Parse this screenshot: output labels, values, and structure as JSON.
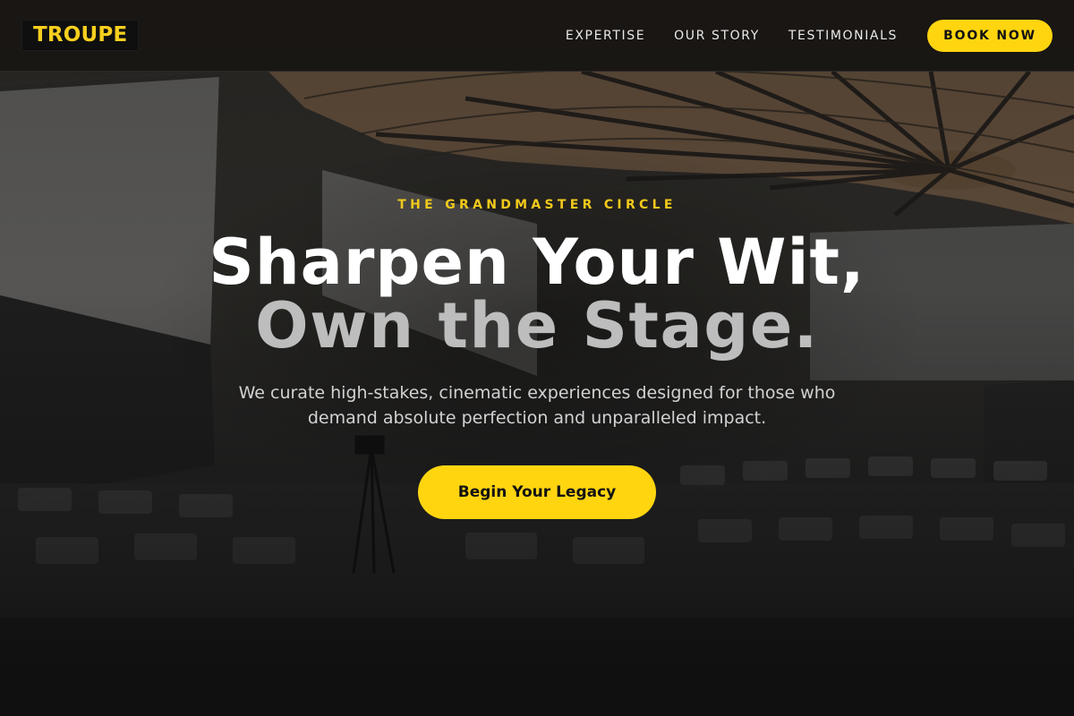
{
  "header": {
    "logo": "TROUPE",
    "nav": [
      {
        "label": "EXPERTISE"
      },
      {
        "label": "OUR STORY"
      },
      {
        "label": "TESTIMONIALS"
      }
    ],
    "cta_label": "BOOK NOW"
  },
  "hero": {
    "background_image": "auditorium-icon",
    "eyebrow": "THE GRANDMASTER CIRCLE",
    "headline_line1": "Sharpen Your Wit,",
    "headline_line2": "Own the Stage.",
    "subtitle": "We curate high-stakes, cinematic experiences designed for those who demand absolute perfection and unparalleled impact.",
    "cta_label": "Begin Your Legacy"
  },
  "colors": {
    "accent": "#ffd510",
    "eyebrow": "#f2c91b",
    "header_bg": "#181614",
    "text_primary": "#ffffff",
    "text_secondary": "#bdbdbd"
  }
}
